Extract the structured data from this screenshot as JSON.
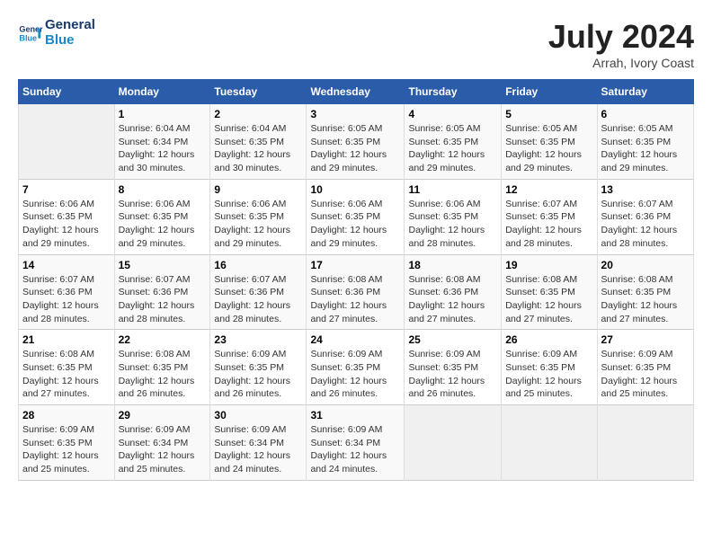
{
  "header": {
    "logo_line1": "General",
    "logo_line2": "Blue",
    "title": "July 2024",
    "location": "Arrah, Ivory Coast"
  },
  "days_of_week": [
    "Sunday",
    "Monday",
    "Tuesday",
    "Wednesday",
    "Thursday",
    "Friday",
    "Saturday"
  ],
  "weeks": [
    [
      {
        "num": "",
        "info": ""
      },
      {
        "num": "1",
        "info": "Sunrise: 6:04 AM\nSunset: 6:34 PM\nDaylight: 12 hours\nand 30 minutes."
      },
      {
        "num": "2",
        "info": "Sunrise: 6:04 AM\nSunset: 6:35 PM\nDaylight: 12 hours\nand 30 minutes."
      },
      {
        "num": "3",
        "info": "Sunrise: 6:05 AM\nSunset: 6:35 PM\nDaylight: 12 hours\nand 29 minutes."
      },
      {
        "num": "4",
        "info": "Sunrise: 6:05 AM\nSunset: 6:35 PM\nDaylight: 12 hours\nand 29 minutes."
      },
      {
        "num": "5",
        "info": "Sunrise: 6:05 AM\nSunset: 6:35 PM\nDaylight: 12 hours\nand 29 minutes."
      },
      {
        "num": "6",
        "info": "Sunrise: 6:05 AM\nSunset: 6:35 PM\nDaylight: 12 hours\nand 29 minutes."
      }
    ],
    [
      {
        "num": "7",
        "info": "Sunrise: 6:06 AM\nSunset: 6:35 PM\nDaylight: 12 hours\nand 29 minutes."
      },
      {
        "num": "8",
        "info": "Sunrise: 6:06 AM\nSunset: 6:35 PM\nDaylight: 12 hours\nand 29 minutes."
      },
      {
        "num": "9",
        "info": "Sunrise: 6:06 AM\nSunset: 6:35 PM\nDaylight: 12 hours\nand 29 minutes."
      },
      {
        "num": "10",
        "info": "Sunrise: 6:06 AM\nSunset: 6:35 PM\nDaylight: 12 hours\nand 29 minutes."
      },
      {
        "num": "11",
        "info": "Sunrise: 6:06 AM\nSunset: 6:35 PM\nDaylight: 12 hours\nand 28 minutes."
      },
      {
        "num": "12",
        "info": "Sunrise: 6:07 AM\nSunset: 6:35 PM\nDaylight: 12 hours\nand 28 minutes."
      },
      {
        "num": "13",
        "info": "Sunrise: 6:07 AM\nSunset: 6:36 PM\nDaylight: 12 hours\nand 28 minutes."
      }
    ],
    [
      {
        "num": "14",
        "info": "Sunrise: 6:07 AM\nSunset: 6:36 PM\nDaylight: 12 hours\nand 28 minutes."
      },
      {
        "num": "15",
        "info": "Sunrise: 6:07 AM\nSunset: 6:36 PM\nDaylight: 12 hours\nand 28 minutes."
      },
      {
        "num": "16",
        "info": "Sunrise: 6:07 AM\nSunset: 6:36 PM\nDaylight: 12 hours\nand 28 minutes."
      },
      {
        "num": "17",
        "info": "Sunrise: 6:08 AM\nSunset: 6:36 PM\nDaylight: 12 hours\nand 27 minutes."
      },
      {
        "num": "18",
        "info": "Sunrise: 6:08 AM\nSunset: 6:36 PM\nDaylight: 12 hours\nand 27 minutes."
      },
      {
        "num": "19",
        "info": "Sunrise: 6:08 AM\nSunset: 6:35 PM\nDaylight: 12 hours\nand 27 minutes."
      },
      {
        "num": "20",
        "info": "Sunrise: 6:08 AM\nSunset: 6:35 PM\nDaylight: 12 hours\nand 27 minutes."
      }
    ],
    [
      {
        "num": "21",
        "info": "Sunrise: 6:08 AM\nSunset: 6:35 PM\nDaylight: 12 hours\nand 27 minutes."
      },
      {
        "num": "22",
        "info": "Sunrise: 6:08 AM\nSunset: 6:35 PM\nDaylight: 12 hours\nand 26 minutes."
      },
      {
        "num": "23",
        "info": "Sunrise: 6:09 AM\nSunset: 6:35 PM\nDaylight: 12 hours\nand 26 minutes."
      },
      {
        "num": "24",
        "info": "Sunrise: 6:09 AM\nSunset: 6:35 PM\nDaylight: 12 hours\nand 26 minutes."
      },
      {
        "num": "25",
        "info": "Sunrise: 6:09 AM\nSunset: 6:35 PM\nDaylight: 12 hours\nand 26 minutes."
      },
      {
        "num": "26",
        "info": "Sunrise: 6:09 AM\nSunset: 6:35 PM\nDaylight: 12 hours\nand 25 minutes."
      },
      {
        "num": "27",
        "info": "Sunrise: 6:09 AM\nSunset: 6:35 PM\nDaylight: 12 hours\nand 25 minutes."
      }
    ],
    [
      {
        "num": "28",
        "info": "Sunrise: 6:09 AM\nSunset: 6:35 PM\nDaylight: 12 hours\nand 25 minutes."
      },
      {
        "num": "29",
        "info": "Sunrise: 6:09 AM\nSunset: 6:34 PM\nDaylight: 12 hours\nand 25 minutes."
      },
      {
        "num": "30",
        "info": "Sunrise: 6:09 AM\nSunset: 6:34 PM\nDaylight: 12 hours\nand 24 minutes."
      },
      {
        "num": "31",
        "info": "Sunrise: 6:09 AM\nSunset: 6:34 PM\nDaylight: 12 hours\nand 24 minutes."
      },
      {
        "num": "",
        "info": ""
      },
      {
        "num": "",
        "info": ""
      },
      {
        "num": "",
        "info": ""
      }
    ]
  ]
}
